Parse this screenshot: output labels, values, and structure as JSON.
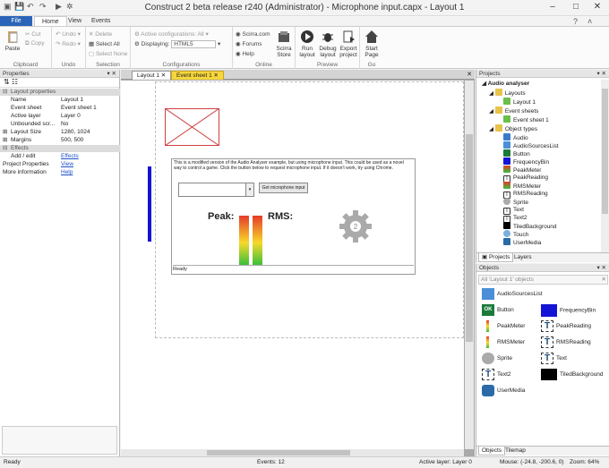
{
  "window": {
    "title": "Construct 2 beta release r240 (Administrator) - Microphone input.capx - Layout 1"
  },
  "ribbon_tabs": [
    "File",
    "Home",
    "View",
    "Events"
  ],
  "ribbon": {
    "clipboard": {
      "paste": "Paste",
      "cut": "Cut",
      "copy": "Copy",
      "label": "Clipboard"
    },
    "undo": {
      "undo": "Undo",
      "redo": "Redo",
      "label": "Undo"
    },
    "selection": {
      "delete": "Delete",
      "select_all": "Select All",
      "select_none": "Select None",
      "label": "Selection"
    },
    "configurations": {
      "active": "Active configurations: All",
      "displaying_label": "Displaying:",
      "displaying_value": "HTML5",
      "label": "Configurations"
    },
    "online": {
      "scirra": "Scirra.com",
      "forums": "Forums",
      "help": "Help",
      "store": "Scirra Store",
      "label": "Online"
    },
    "preview": {
      "run": "Run layout",
      "debug": "Debug layout",
      "export": "Export project",
      "label": "Preview"
    },
    "go": {
      "start": "Start Page",
      "label": "Go"
    }
  },
  "properties": {
    "title": "Properties",
    "section1": "Layout properties",
    "rows": [
      {
        "k": "Name",
        "v": "Layout 1"
      },
      {
        "k": "Event sheet",
        "v": "Event sheet 1"
      },
      {
        "k": "Active layer",
        "v": "Layer 0"
      },
      {
        "k": "Unbounded scr...",
        "v": "No"
      },
      {
        "k": "Layout Size",
        "v": "1280, 1024"
      },
      {
        "k": "Margins",
        "v": "500, 500"
      }
    ],
    "section2": "Effects",
    "add_edit": {
      "k": "Add / edit",
      "v": "Effects"
    },
    "project_props": {
      "k": "Project Properties",
      "v": "View"
    },
    "more_info": {
      "k": "More information",
      "v": "Help"
    }
  },
  "editor_tabs": [
    "Layout 1",
    "Event sheet 1"
  ],
  "layout": {
    "description": "This is a modified version of the Audio Analyser example, but using microphone input. This could be used as a novel way to control a game. Click the button below to request microphone input. If it doesn't work, try using Chrome.",
    "button": "Get microphone input",
    "peak": "Peak:",
    "rms": "RMS:",
    "status": "Ready"
  },
  "projects": {
    "title": "Projects",
    "root": "Audio analyser",
    "layouts_folder": "Layouts",
    "layout1": "Layout 1",
    "eventsheets_folder": "Event sheets",
    "eventsheet1": "Event sheet 1",
    "objtypes_folder": "Object types",
    "objects": [
      "Audio",
      "AudioSourcesList",
      "Button",
      "FrequencyBin",
      "PeakMeter",
      "PeakReading",
      "RMSMeter",
      "RMSReading",
      "Sprite",
      "Text",
      "Text2",
      "TiledBackground",
      "Touch",
      "UserMedia"
    ],
    "tabs": [
      "Projects",
      "Layers"
    ]
  },
  "objects_panel": {
    "title": "Objects",
    "filter": "All 'Layout 1' objects",
    "left": [
      "AudioSourcesList",
      "Button",
      "PeakMeter",
      "RMSMeter",
      "Sprite",
      "Text2",
      "UserMedia"
    ],
    "right": [
      "FrequencyBin",
      "PeakReading",
      "RMSReading",
      "Text",
      "TiledBackground"
    ],
    "tabs": [
      "Objects",
      "Tilemap"
    ]
  },
  "status": {
    "ready": "Ready",
    "events": "Events: 12",
    "layer": "Active layer: Layer 0",
    "mouse": "Mouse: (-24.8, -200.6, 0)",
    "zoom": "Zoom: 64%"
  },
  "colors": {
    "accent": "#2b64b8",
    "canvas_bg": "#a9a9a9",
    "meter_top": "#e53a2a",
    "meter_bottom": "#3ac03a"
  }
}
